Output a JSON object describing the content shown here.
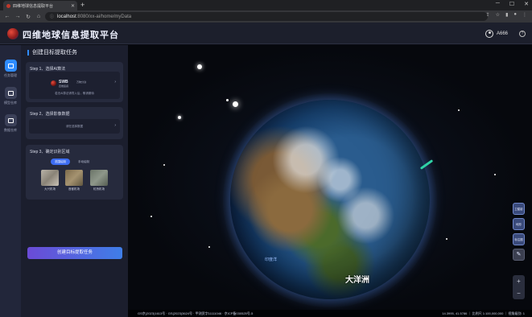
{
  "browser": {
    "tab_title": "四维地球信息提取平台",
    "new_tab": "+",
    "url_host": "localhost",
    "url_path": ":8080/xx-ai/home/myData",
    "window_controls": [
      "─",
      "☐",
      "✕"
    ]
  },
  "header": {
    "app_title": "四维地球信息提取平台",
    "username": "A666"
  },
  "rail": {
    "items": [
      {
        "label": "任务管理",
        "active": true
      },
      {
        "label": "模型仓库",
        "active": false
      },
      {
        "label": "数据仓库",
        "active": false
      }
    ]
  },
  "panel": {
    "title": "创建目标提取任务",
    "step1": {
      "label": "Step 1、选择AI算法",
      "model_name": "SWB",
      "model_tag": "万物分割",
      "model_sub": "四维遥感",
      "hint": "若无AI算法请导入后，敬请期待"
    },
    "step2": {
      "label": "Step 2、选择影像数据",
      "placeholder": "请在选择数据"
    },
    "step3": {
      "label": "Step 3、确定识别区域",
      "mode_on": "范围绘制",
      "mode_off": "手动绘制",
      "samples": [
        {
          "label": "大兴机场"
        },
        {
          "label": "首都机场"
        },
        {
          "label": "虹桥机场"
        }
      ]
    },
    "cta": "创建目标提取任务"
  },
  "map": {
    "label_sea": "印度洋",
    "label_ocean": "大洋洲",
    "tools": [
      "卫星影像",
      "地形",
      "标注图层"
    ],
    "zoom_in": "+",
    "zoom_out": "−",
    "status_left": "GS京(2023)1613号 · GS(2023)3624号 · 甲测资字11111046 · 京ICP备030525号-5",
    "status_right": "14.3995, 41.5786 ｜ 比例尺 1:100,000,000 ｜ 视角级别: 1"
  },
  "colors": {
    "accent": "#2f8cff",
    "cta_start": "#6b4bd6",
    "cta_end": "#3f7ee8",
    "satellite": "#2fd2a6"
  }
}
